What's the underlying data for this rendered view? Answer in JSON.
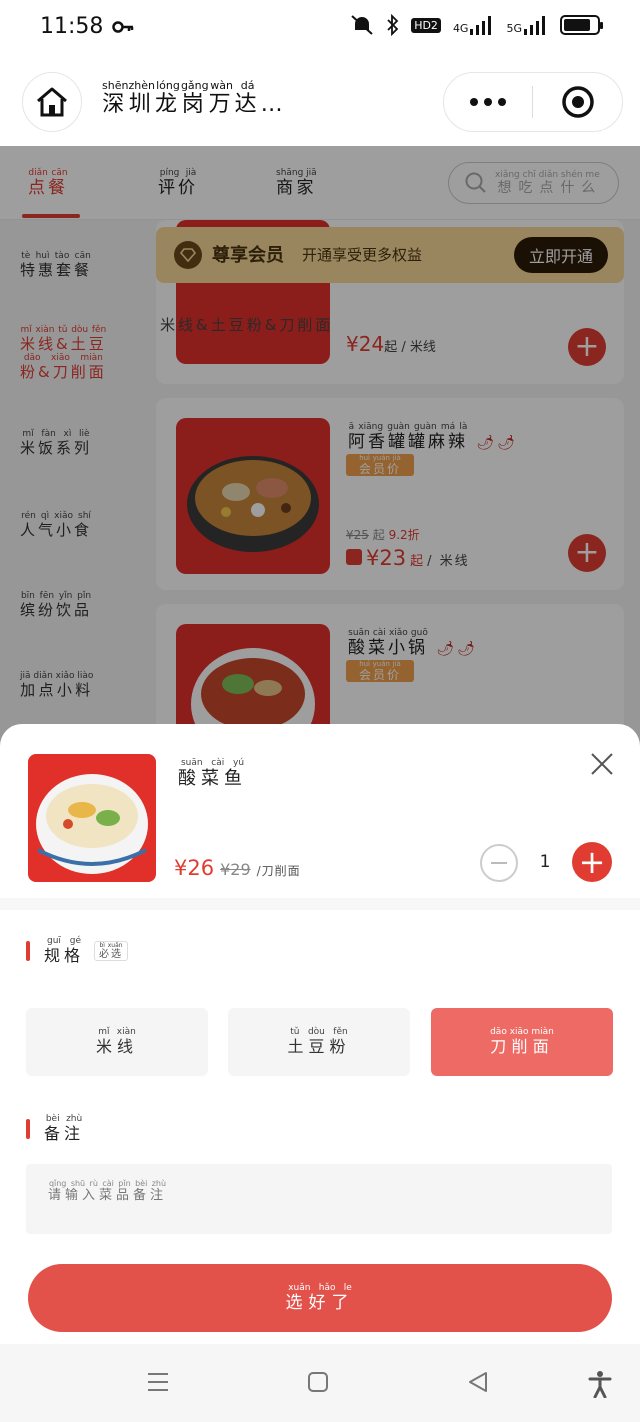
{
  "status_bar": {
    "time": "11:58",
    "network_1": "4G",
    "network_2": "5G",
    "hd": "HD2"
  },
  "title_bar": {
    "store_name": [
      {
        "c": "深",
        "p": "shēn"
      },
      {
        "c": "圳",
        "p": "zhèn"
      },
      {
        "c": "龙",
        "p": "lóng"
      },
      {
        "c": "岗",
        "p": "gǎng"
      },
      {
        "c": "万",
        "p": "wàn"
      },
      {
        "c": "达",
        "p": "dá"
      }
    ],
    "ellipsis": "…"
  },
  "tabs": [
    {
      "text": "点餐",
      "pinyin": "diǎn cān"
    },
    {
      "text": "评价",
      "pinyin": "píng jià"
    },
    {
      "text": "商家",
      "pinyin": "shāng jiā"
    }
  ],
  "search": {
    "placeholder": "想吃点什么",
    "pinyin": "xiǎng chī diǎn shén me"
  },
  "left_nav": [
    {
      "text": "特惠套餐",
      "pinyin": "tè huì tào cān"
    },
    {
      "text": "米线&土豆粉&刀削面",
      "pinyin": "mǐ xiàn tǔ dòu fěn dāo xiāo miàn"
    },
    {
      "text": "米饭系列",
      "pinyin": "mǐ fàn xì liè"
    },
    {
      "text": "人气小食",
      "pinyin": "rén qì xiǎo shí"
    },
    {
      "text": "缤纷饮品",
      "pinyin": "bīn fēn yǐn pǐn"
    },
    {
      "text": "加点小料",
      "pinyin": "jiā diǎn xiǎo liào"
    }
  ],
  "vip": {
    "title": "尊享会员",
    "subtitle": "开通享受更多权益",
    "button": "立即开通"
  },
  "category_header": "米线&土豆粉&刀削面",
  "partial_card": {
    "price": "¥24",
    "suffix": "起 / 米线"
  },
  "products": [
    {
      "name": "阿香罐罐麻辣",
      "name_pinyin": "ā xiāng guàn guàn má là",
      "spicy": "🌶🌶",
      "tag": "会员价",
      "orig_price": "¥25",
      "orig_suffix": "起",
      "discount": "9.2折",
      "price": "¥23",
      "price_suffix": "起",
      "unit": "/ 米线"
    },
    {
      "name": "酸菜小锅",
      "name_pinyin": "suān cài xiǎo guō",
      "spicy": "🌶🌶",
      "tag": "会员价"
    }
  ],
  "sheet": {
    "name": "酸菜鱼",
    "name_pinyin": "suān cài yú",
    "price": "¥26",
    "orig_price": "¥29",
    "unit": "/刀削面",
    "quantity": "1",
    "spec_label": "规格",
    "spec_pinyin": "guī gé",
    "required": "必选",
    "options": [
      {
        "text": "米线",
        "selected": false
      },
      {
        "text": "土豆粉",
        "selected": false
      },
      {
        "text": "刀削面",
        "selected": true
      }
    ],
    "note_label": "备注",
    "note_placeholder": "请输入菜品备注",
    "confirm": "选好了"
  },
  "colors": {
    "accent": "#e03c32",
    "vip_bg": "#f7d99a",
    "confirm": "#e2524b"
  }
}
